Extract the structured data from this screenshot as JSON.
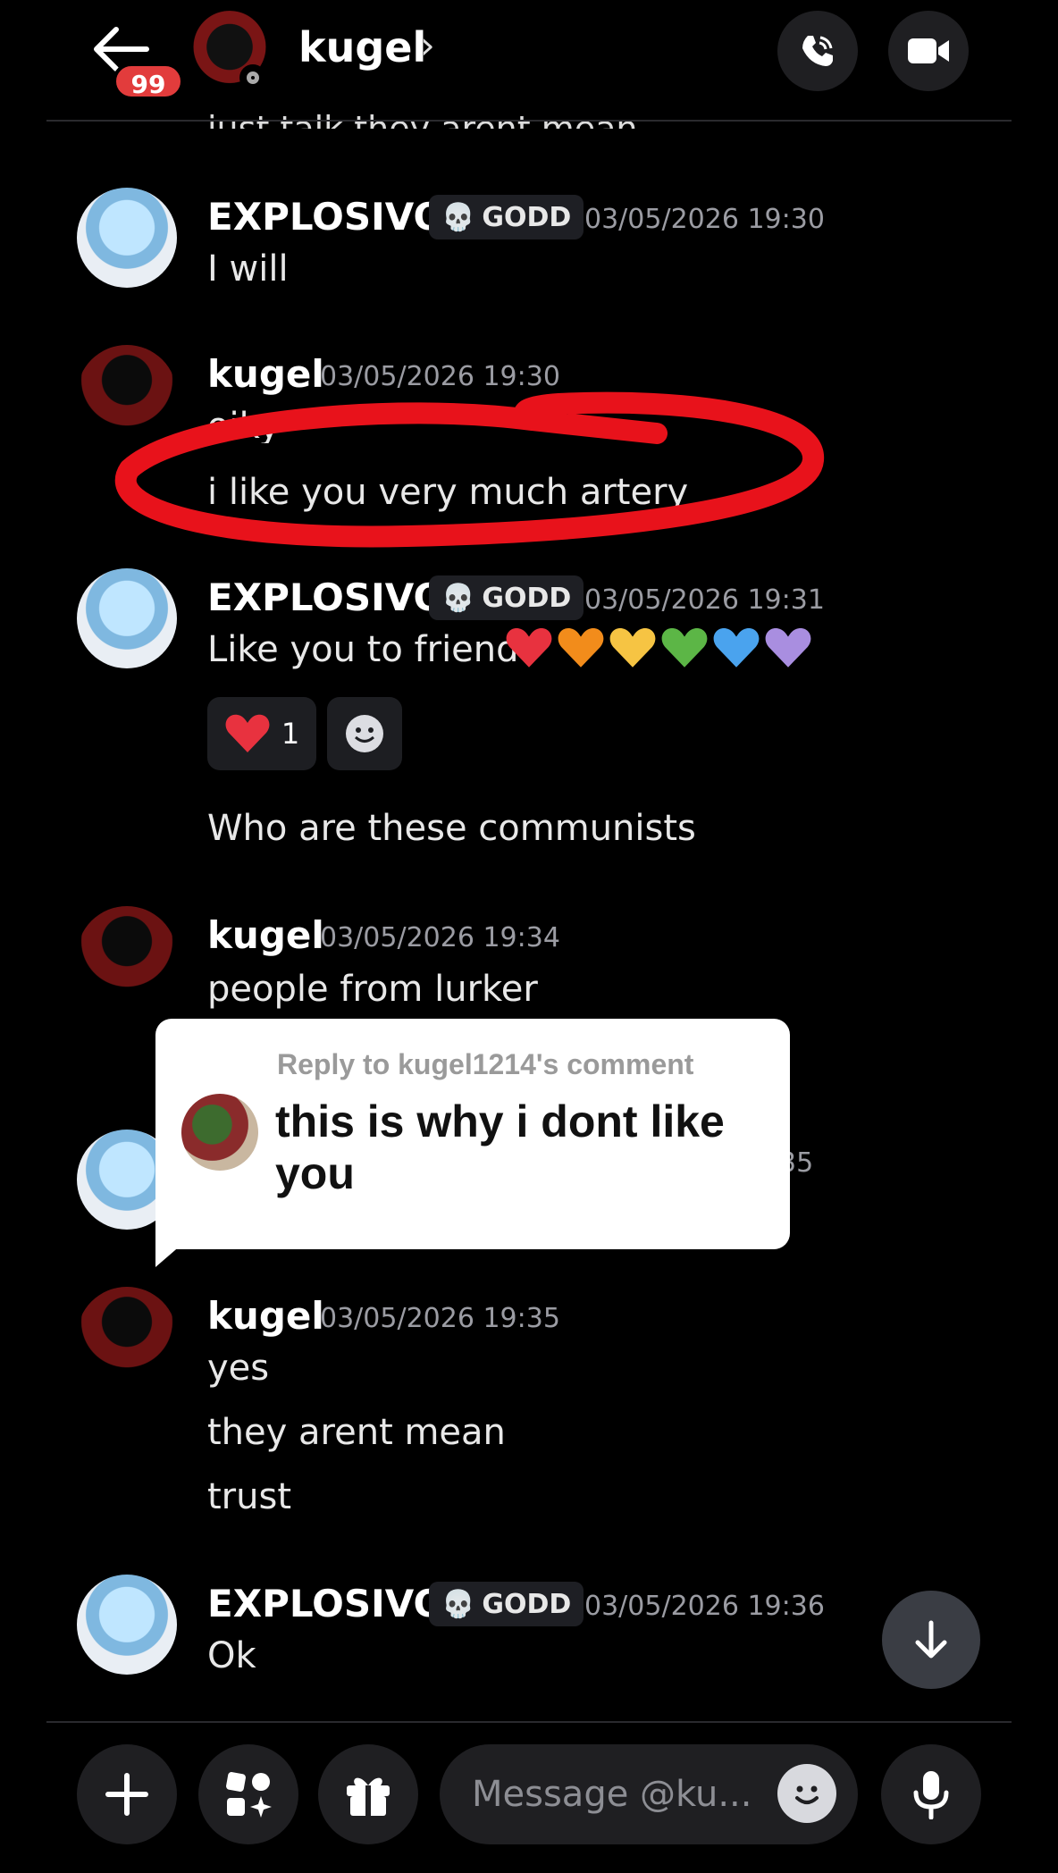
{
  "header": {
    "name": "kugel",
    "chevron": "›",
    "unread_badge": "99",
    "cut_off_message": "just talk they arent mean"
  },
  "messages": [
    {
      "author": "EXPLOSIVO",
      "tag": "GODD",
      "time": "03/05/2026 19:30",
      "lines": [
        "I will"
      ]
    },
    {
      "author": "kugel",
      "time": "03/05/2026 19:30",
      "lines": [
        "oiky",
        "i like you very much artery"
      ]
    },
    {
      "author": "EXPLOSIVO",
      "tag": "GODD",
      "time": "03/05/2026 19:31",
      "lines": [
        "Like you to friend",
        "Who are these communists"
      ],
      "reaction": {
        "emoji": "heart",
        "count": "1"
      }
    },
    {
      "author": "kugel",
      "time": "03/05/2026 19:34",
      "lines": [
        "people from lurker"
      ]
    },
    {
      "partial_time": "35"
    },
    {
      "author": "kugel",
      "time": "03/05/2026 19:35",
      "lines": [
        "yes",
        "they arent mean",
        "trust"
      ]
    },
    {
      "author": "EXPLOSIVO",
      "tag": "GODD",
      "time": "03/05/2026 19:36",
      "lines": [
        "Ok"
      ]
    }
  ],
  "heart_colors": [
    "#e8323f",
    "#f28c1b",
    "#f6c443",
    "#5cb646",
    "#4aa3ee",
    "#a98ee0"
  ],
  "reply_card": {
    "label": "Reply to kugel1214's comment",
    "text": "this is why i dont like you"
  },
  "composer": {
    "placeholder": "Message @ku..."
  },
  "colors": {
    "annotation_red": "#e8121b",
    "badge_red": "#e23c3c"
  }
}
